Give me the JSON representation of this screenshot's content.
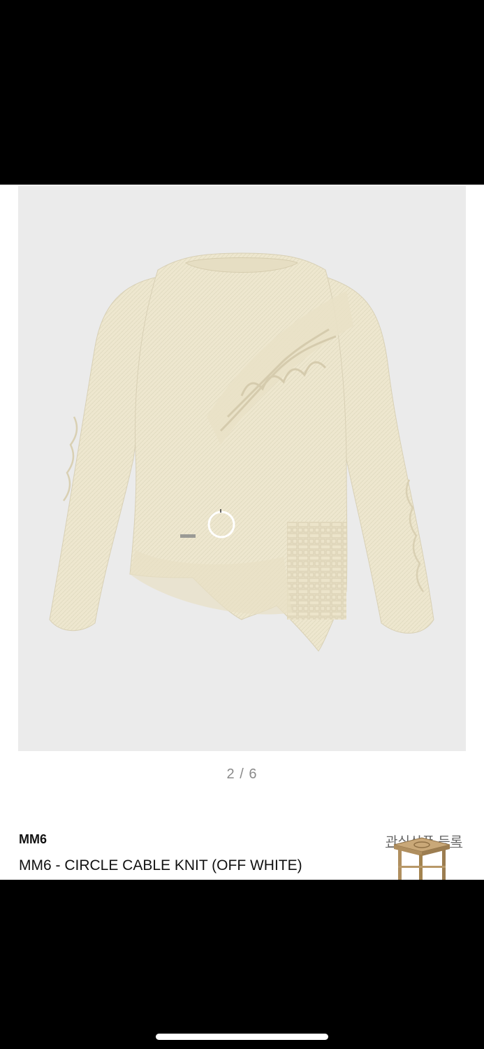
{
  "gallery": {
    "image_alt": "MM6 circle cable knit sweater, off white",
    "pager": "2 / 6",
    "loading_icon": "loading-ring-icon"
  },
  "product": {
    "brand": "MM6",
    "title": "MM6 - CIRCLE CABLE KNIT (OFF WHITE)"
  },
  "wishlist": {
    "label": "관심상품 등록",
    "icon": "stool-icon"
  },
  "colors": {
    "knit": "#eee7cf",
    "photo_bg": "#ebebeb",
    "text": "#111111"
  }
}
